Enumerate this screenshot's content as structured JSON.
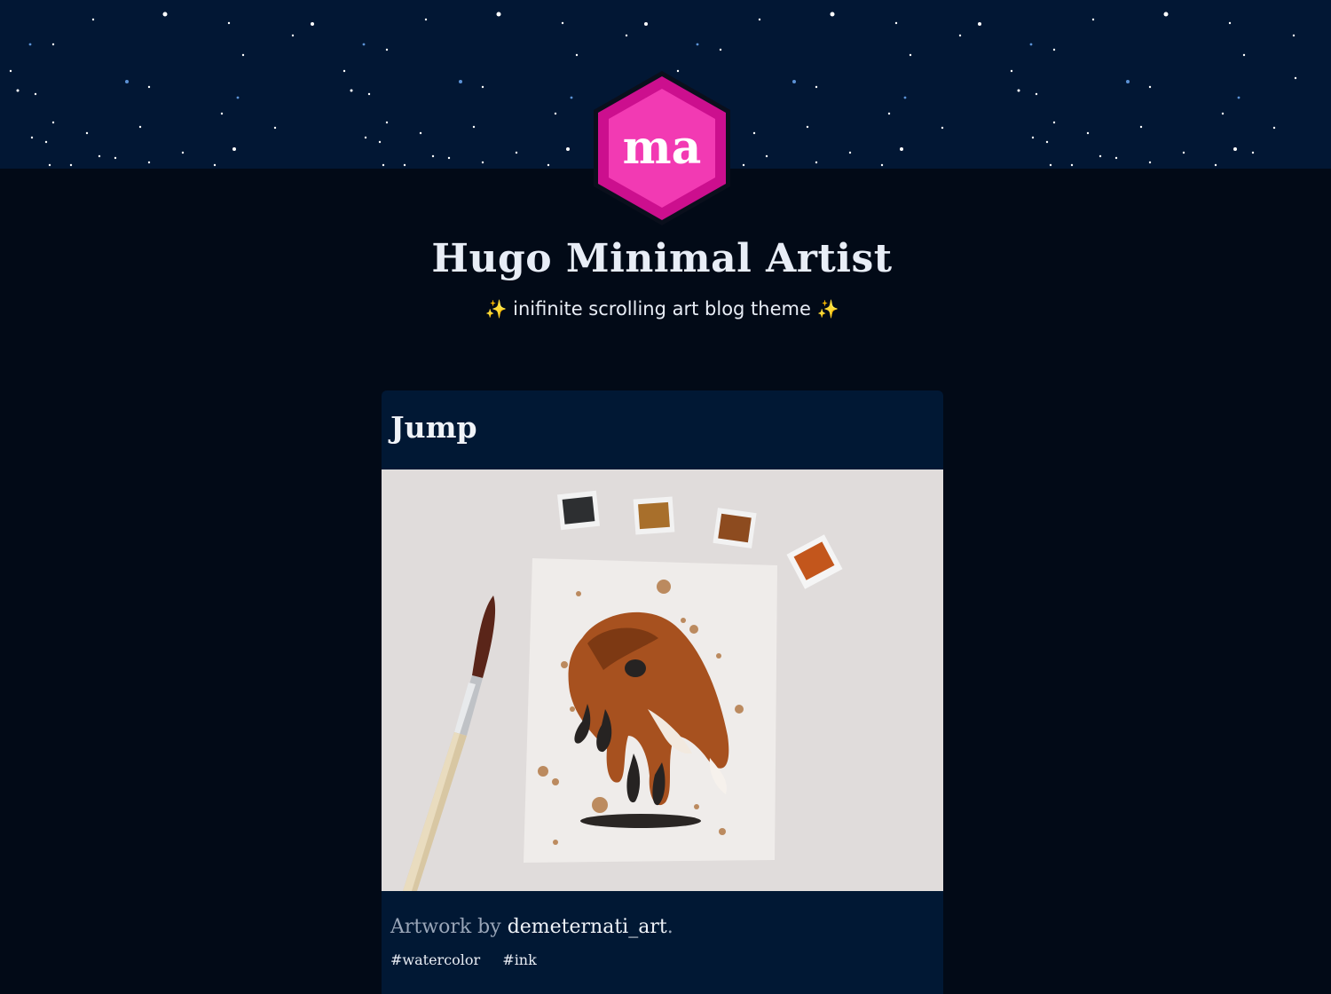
{
  "header": {
    "logo_text": "ma",
    "title": "Hugo Minimal Artist",
    "tagline_sparkle_left": "✨",
    "tagline": "inifinite scrolling art blog theme",
    "tagline_sparkle_right": "✨"
  },
  "post": {
    "title": "Jump",
    "image_icon": "fox-watercolor-artwork",
    "credit_prefix": "Artwork by",
    "credit_author": "demeternati_art",
    "credit_suffix": ".",
    "tags": [
      "#watercolor",
      "#ink"
    ]
  },
  "colors": {
    "background": "#020a17",
    "starfield": "#021734",
    "card": "#011834",
    "logo_pink": "#f23ab3",
    "logo_border": "#cc0f8e",
    "sparkle": "#f3b531"
  }
}
